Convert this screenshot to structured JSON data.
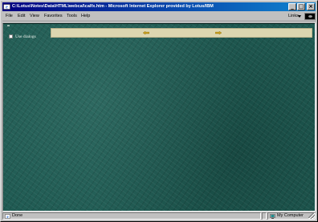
{
  "window": {
    "title": "C:\\Lotus\\Notes\\Data\\HTML\\webcal\\calfx.htm - Microsoft Internet Explorer provided by Lotus/IBM"
  },
  "title_buttons": {
    "minimize": "_",
    "maximize": "□",
    "close": "×"
  },
  "menu": {
    "items": [
      "File",
      "Edit",
      "View",
      "Favorites",
      "Tools",
      "Help"
    ],
    "links_label": "Links"
  },
  "content": {
    "dialog_checkbox_label": "Use dialogs",
    "dialog_checked": false,
    "nav_bar_color": "#dcd6b0",
    "background_color": "#1f5a52",
    "arrow_color": "#c8a020"
  },
  "status": {
    "text": "Done",
    "zone": "My Computer"
  }
}
